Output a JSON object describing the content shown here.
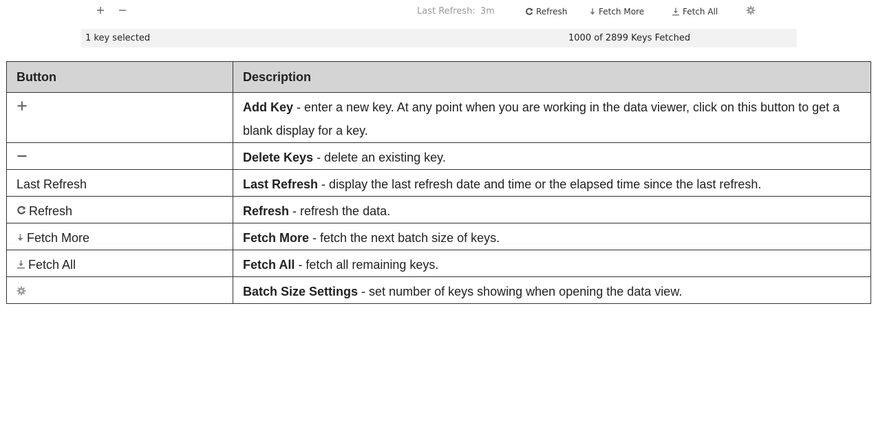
{
  "toolbar": {
    "add_icon": "plus-icon",
    "delete_icon": "minus-icon",
    "last_refresh_label": "Last Refresh:",
    "last_refresh_value": "3m",
    "refresh_label": "Refresh",
    "refresh_icon": "refresh-icon",
    "fetch_more_label": "Fetch More",
    "fetch_more_icon": "arrow-down-icon",
    "fetch_all_label": "Fetch All",
    "fetch_all_icon": "arrow-down-to-line-icon",
    "settings_icon": "gear-icon"
  },
  "status": {
    "selection": "1 key selected",
    "fetched": "1000 of 2899 Keys Fetched"
  },
  "table": {
    "headers": [
      "Button",
      "Description"
    ],
    "rows": [
      {
        "button_icon": "plus-icon",
        "button_label": "",
        "title": "Add Key",
        "text": " - enter a new key. At any point when you are working in the data viewer, click on this button to get a blank display for a key."
      },
      {
        "button_icon": "minus-icon",
        "button_label": "",
        "title": "Delete Keys",
        "text": " - delete an existing key."
      },
      {
        "button_icon": "",
        "button_label": "Last Refresh",
        "title": "Last Refresh",
        "text": " - display the last refresh date and time or the elapsed time since the last refresh."
      },
      {
        "button_icon": "refresh-icon",
        "button_label": "Refresh",
        "title": "Refresh",
        "text": " - refresh the data."
      },
      {
        "button_icon": "arrow-down-icon",
        "button_label": "Fetch More",
        "title": "Fetch More",
        "text": " - fetch the next batch size of keys."
      },
      {
        "button_icon": "arrow-down-to-line-icon",
        "button_label": "Fetch All",
        "title": "Fetch All",
        "text": " - fetch all remaining keys."
      },
      {
        "button_icon": "gear-icon",
        "button_label": "",
        "title": "Batch Size Settings",
        "text": " - set number of keys showing when opening the data view."
      }
    ]
  },
  "colors": {
    "header_bg": "#d4d4d4",
    "statusbar_bg": "#f2f2f2",
    "muted_text": "#9a9a9a"
  }
}
